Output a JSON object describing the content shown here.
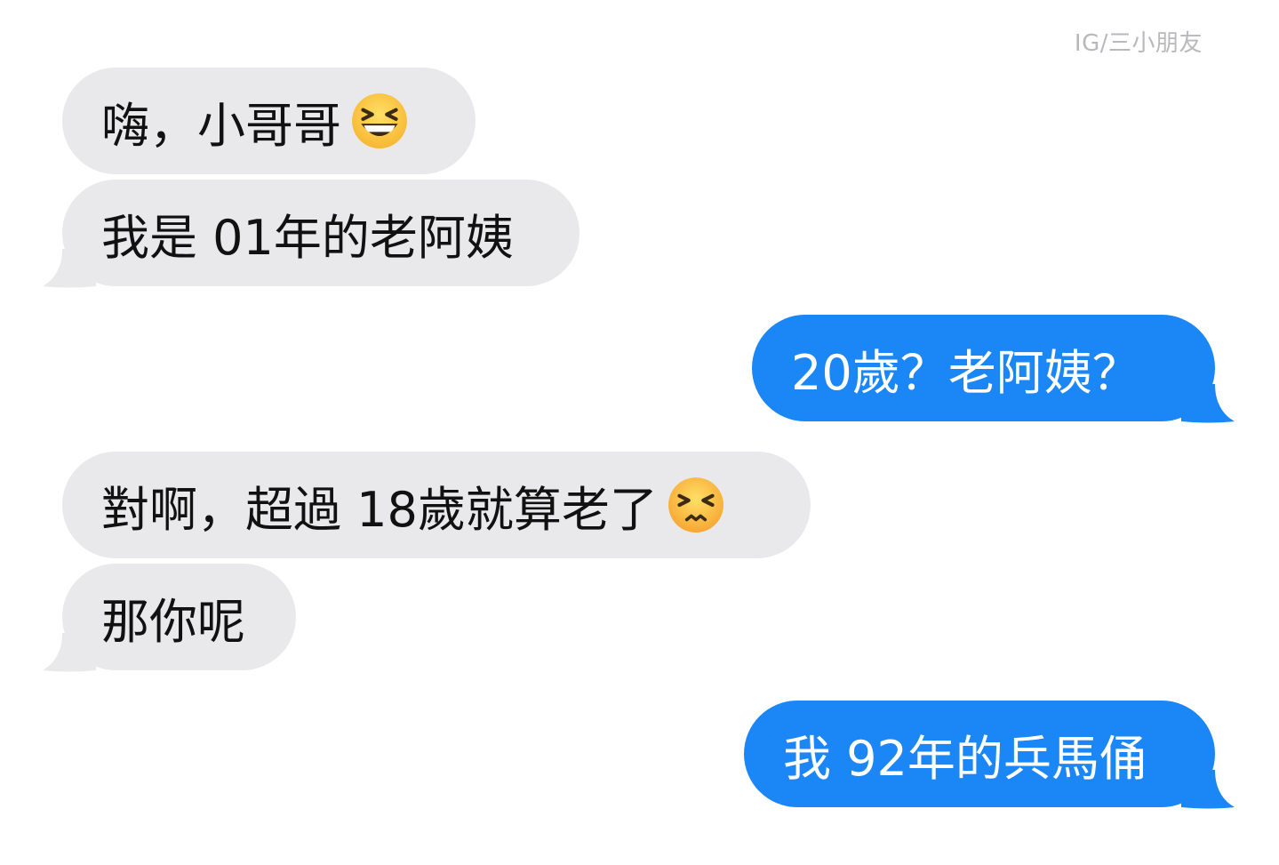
{
  "watermark": "IG/三小朋友",
  "messages": [
    {
      "text": "嗨，小哥哥",
      "emoji": "grinning-squinting-face-icon",
      "sender": "them"
    },
    {
      "text": "我是 01年的老阿姨",
      "sender": "them"
    },
    {
      "text": "20歲？老阿姨？",
      "sender": "me"
    },
    {
      "text": "對啊，超過 18歲就算老了",
      "emoji": "persevering-face-icon",
      "sender": "them"
    },
    {
      "text": "那你呢",
      "sender": "them"
    },
    {
      "text": "我 92年的兵馬俑",
      "sender": "me"
    }
  ],
  "colors": {
    "incoming_bubble": "#e9e9eb",
    "outgoing_bubble": "#1b86f5"
  }
}
